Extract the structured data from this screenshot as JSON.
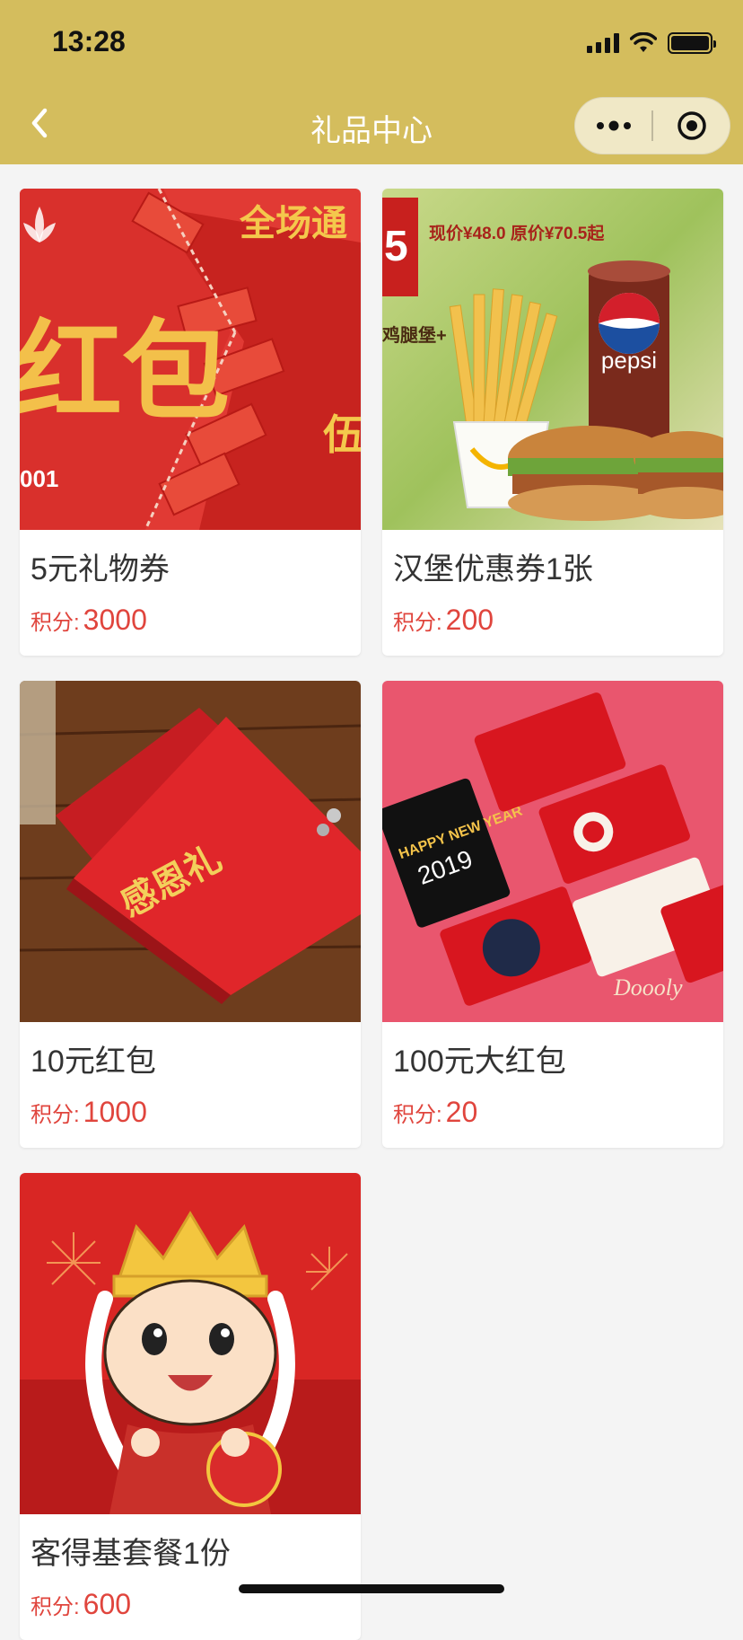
{
  "status_bar": {
    "time": "13:28"
  },
  "nav": {
    "title": "礼品中心"
  },
  "gifts": [
    {
      "name": "5元礼物券",
      "points_label": "积分:",
      "points": "3000"
    },
    {
      "name": "汉堡优惠券1张",
      "points_label": "积分:",
      "points": "200"
    },
    {
      "name": "10元红包",
      "points_label": "积分:",
      "points": "1000"
    },
    {
      "name": "100元大红包",
      "points_label": "积分:",
      "points": "20"
    },
    {
      "name": "客得基套餐1份",
      "points_label": "积分:",
      "points": "600"
    }
  ],
  "images": {
    "gift0": {
      "big_text": "红包",
      "tagline": "全场通",
      "code": "001",
      "side_text": "伍"
    },
    "gift1": {
      "price_text": "现价¥48.0 原价¥70.5起",
      "badge": "5",
      "side_text": "鸡腿堡+",
      "brand": "pepsi"
    },
    "gift2": {
      "cover_text": "感恩礼"
    },
    "gift3": {
      "card_text": "HAPPY NEW YEAR",
      "year": "2019",
      "brand": "Doooly"
    }
  },
  "colors": {
    "accent": "#d4bd5d",
    "price": "#e0453d"
  }
}
